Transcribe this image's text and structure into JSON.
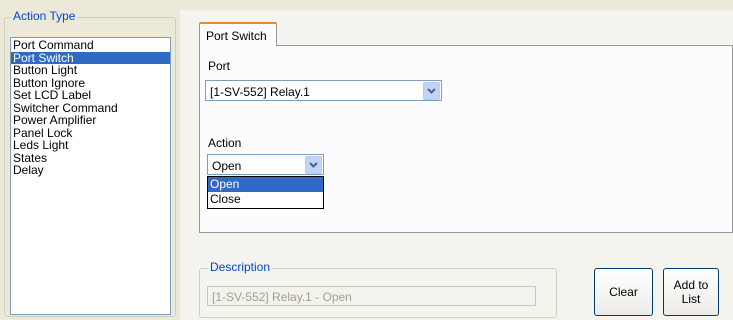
{
  "action_type": {
    "legend": "Action Type",
    "items": [
      "Port Command",
      "Port Switch",
      "Button Light",
      "Button Ignore",
      "Set LCD Label",
      "Switcher Command",
      "Power Amplifier",
      "Panel Lock",
      "Leds Light",
      "States",
      "Delay"
    ],
    "selected": "Port Switch"
  },
  "tab": {
    "label": "Port Switch"
  },
  "port": {
    "label": "Port",
    "value": "[1-SV-552] Relay.1",
    "button_icon": "chevron-down-icon"
  },
  "action": {
    "label": "Action",
    "value": "Open",
    "options": [
      "Open",
      "Close"
    ],
    "selected": "Open",
    "button_icon": "chevron-down-icon"
  },
  "description": {
    "legend": "Description",
    "value": "[1-SV-552] Relay.1 - Open"
  },
  "buttons": {
    "clear": "Clear",
    "add_line1": "Add to",
    "add_line2": "List"
  },
  "colors": {
    "selection": "#316ac5",
    "legend": "#0046d5",
    "tab_accent": "#e68b2c",
    "window_bg": "#ece9d8"
  }
}
